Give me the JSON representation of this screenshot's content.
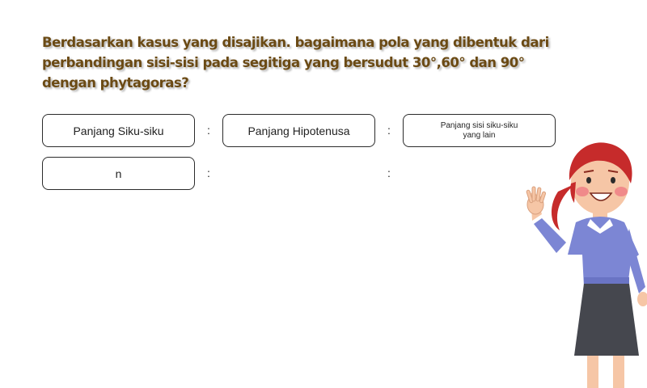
{
  "question": "Berdasarkan kasus yang disajikan. bagaimana pola yang dibentuk dari perbandingan sisi-sisi pada segitiga yang bersudut 30°,60° dan 90° dengan phytagoras?",
  "header_row": {
    "box1": "Panjang Siku-siku",
    "box2": "Panjang Hipotenusa",
    "box3_line1": "Panjang sisi siku-siku",
    "box3_line2": "yang lain",
    "sep1": ":",
    "sep2": ":"
  },
  "answer_row": {
    "box1": "n",
    "sep1": ":",
    "sep2": ":"
  },
  "colors": {
    "question_text": "#6b4a14",
    "box_border": "#2b2b2b"
  },
  "illustration": {
    "icon": "teacher-waving-illustration"
  }
}
